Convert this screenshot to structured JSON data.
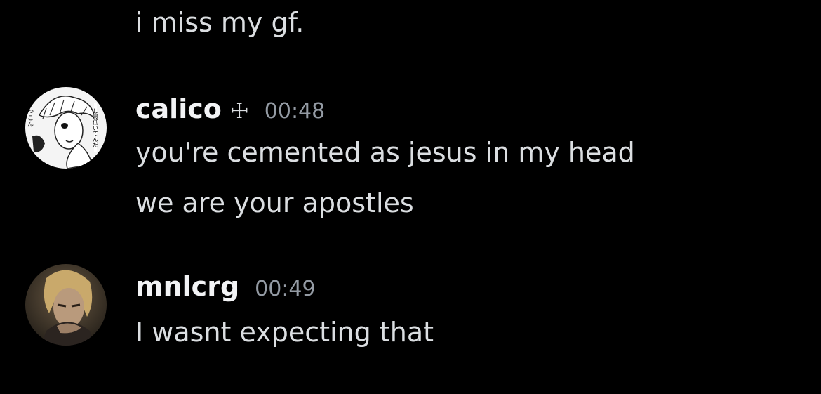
{
  "messages": {
    "first": {
      "text": "i miss my gf."
    },
    "calico": {
      "username": "calico",
      "badge": "☩",
      "timestamp": "00:48",
      "lines": [
        "you're cemented as jesus in my head",
        "we are your apostles"
      ]
    },
    "mnlcrg": {
      "username": "mnlcrg",
      "timestamp": "00:49",
      "lines": [
        "I wasnt expecting that"
      ]
    }
  },
  "colors": {
    "background": "#000000",
    "message_text": "#dbdee1",
    "username": "#f2f3f5",
    "timestamp": "#949ba4"
  }
}
